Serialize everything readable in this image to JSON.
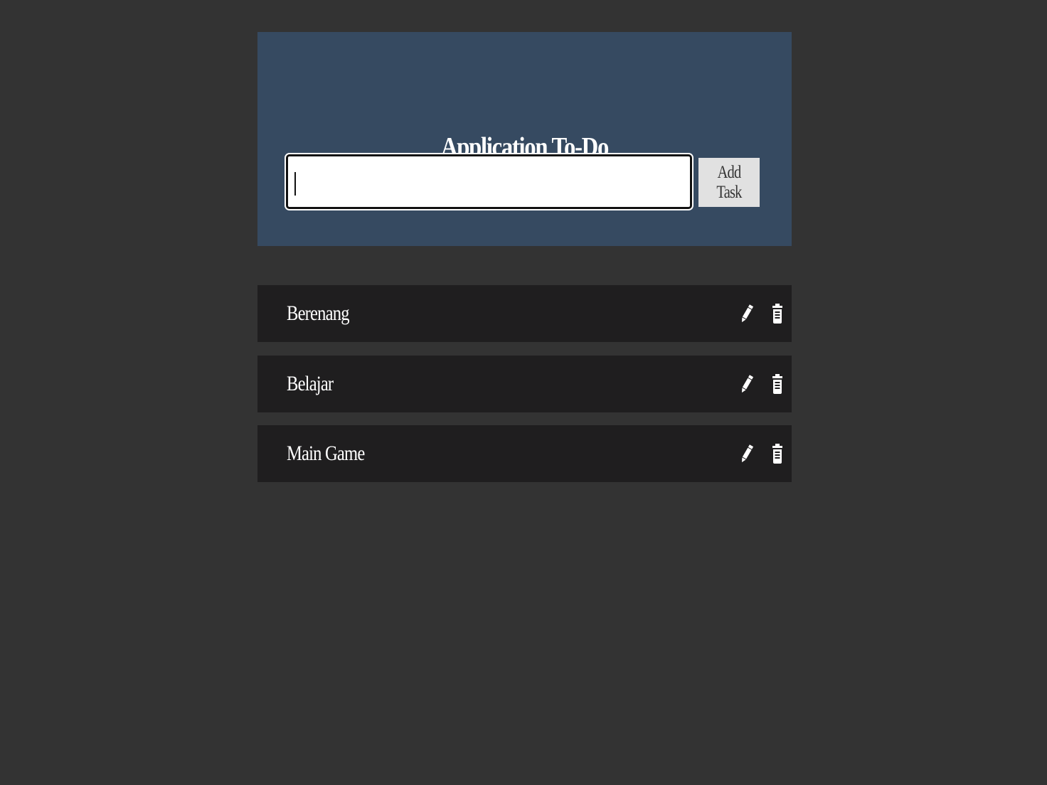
{
  "app": {
    "title": "Application To-Do"
  },
  "form": {
    "input_value": "",
    "input_placeholder": "",
    "add_button_label": "Add Task"
  },
  "tasks": [
    {
      "label": "Berenang"
    },
    {
      "label": "Belajar"
    },
    {
      "label": "Main Game"
    }
  ],
  "icons": {
    "edit": "pencil-icon",
    "delete": "trash-icon"
  },
  "colors": {
    "page_background": "#333333",
    "header_background": "#364a61",
    "task_background": "#1f1e1f",
    "button_background": "#e1e1e1",
    "text": "#ffffff"
  }
}
